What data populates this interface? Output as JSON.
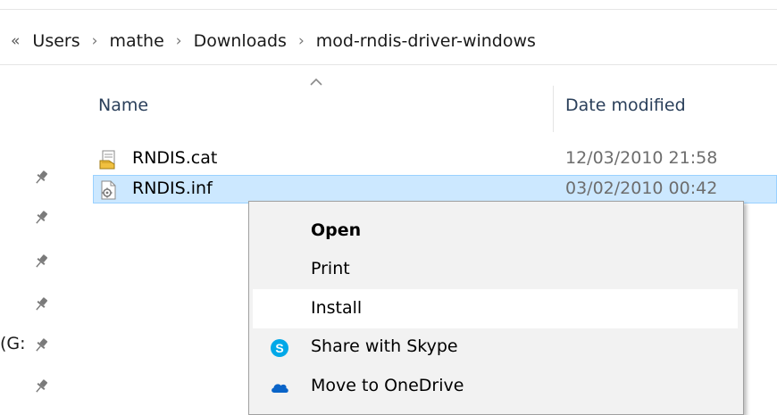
{
  "address_bar": {
    "overflow_label": "«",
    "separator": "›",
    "crumbs": [
      "Users",
      "mathe",
      "Downloads",
      "mod-rndis-driver-windows"
    ]
  },
  "nav": {
    "partial_drive_label": "(G:"
  },
  "file_list": {
    "columns": {
      "name": "Name",
      "date_modified": "Date modified"
    },
    "sort_icon": "sort-ascending-icon",
    "rows": [
      {
        "name": "RNDIS.cat",
        "date": "12/03/2010 21:58",
        "icon": "security-catalog-icon",
        "selected": false
      },
      {
        "name": "RNDIS.inf",
        "date": "03/02/2010 00:42",
        "icon": "setup-information-icon",
        "selected": true
      }
    ]
  },
  "context_menu": {
    "items": [
      {
        "label": "Open",
        "bold": true,
        "icon": null
      },
      {
        "label": "Print",
        "bold": false,
        "icon": null
      },
      {
        "label": "Install",
        "bold": false,
        "icon": null,
        "hover": true
      },
      {
        "label": "Share with Skype",
        "bold": false,
        "icon": "skype-icon"
      },
      {
        "label": "Move to OneDrive",
        "bold": false,
        "icon": "onedrive-icon"
      }
    ]
  },
  "colors": {
    "selection_bg": "#cce8ff",
    "selection_border": "#99d1ff",
    "menu_bg": "#f2f2f2",
    "menu_hover": "#ffffff",
    "header_text": "#2a3f5a",
    "skype_blue": "#00a8e8",
    "onedrive_blue": "#0a64c8"
  }
}
